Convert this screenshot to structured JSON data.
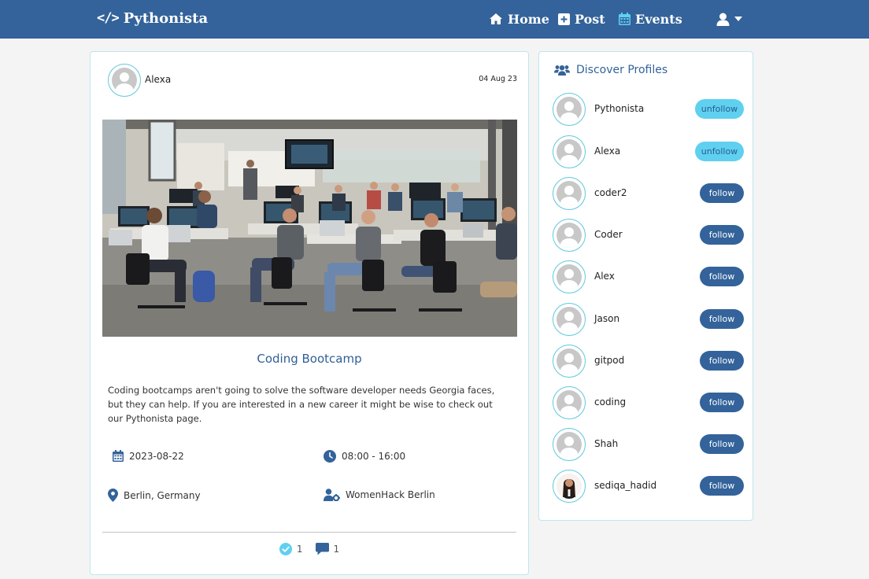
{
  "navbar": {
    "brand_code": "</>",
    "brand": "Pythonista",
    "home": "Home",
    "post": "Post",
    "events": "Events"
  },
  "post": {
    "author": "Alexa",
    "date": "04 Aug 23",
    "title": "Coding Bootcamp",
    "body": "Coding bootcamps aren't going to solve the software developer needs Georgia faces, but they can help. If you are interested in a new career it might be wise to check out our Pythonista page.",
    "event_date": "2023-08-22",
    "event_time": "08:00 - 16:00",
    "location": "Berlin, Germany",
    "host": "WomenHack Berlin",
    "likes": "1",
    "comments": "1"
  },
  "discover": {
    "title": "Discover Profiles",
    "profiles": [
      {
        "name": "Pythonista",
        "button": "unfollow"
      },
      {
        "name": "Alexa",
        "button": "unfollow"
      },
      {
        "name": "coder2",
        "button": "follow"
      },
      {
        "name": "Coder",
        "button": "follow"
      },
      {
        "name": "Alex",
        "button": "follow"
      },
      {
        "name": "Jason",
        "button": "follow"
      },
      {
        "name": "gitpod",
        "button": "follow"
      },
      {
        "name": "coding",
        "button": "follow"
      },
      {
        "name": "Shah",
        "button": "follow"
      },
      {
        "name": "sediqa_hadid",
        "button": "follow"
      }
    ]
  },
  "colors": {
    "navbar": "#33639a",
    "accent": "#5fd0f0",
    "follow_button": "#33639a",
    "card_border": "#bfe6ee"
  },
  "icons": {
    "home": "home-icon",
    "post": "plus-square-icon",
    "events": "calendar-icon",
    "user": "user-icon",
    "date": "calendar-icon",
    "time": "clock-icon",
    "location": "map-pin-icon",
    "host": "users-cog-icon",
    "likes": "check-circle-icon",
    "comments": "comment-icon",
    "discover": "users-icon"
  }
}
